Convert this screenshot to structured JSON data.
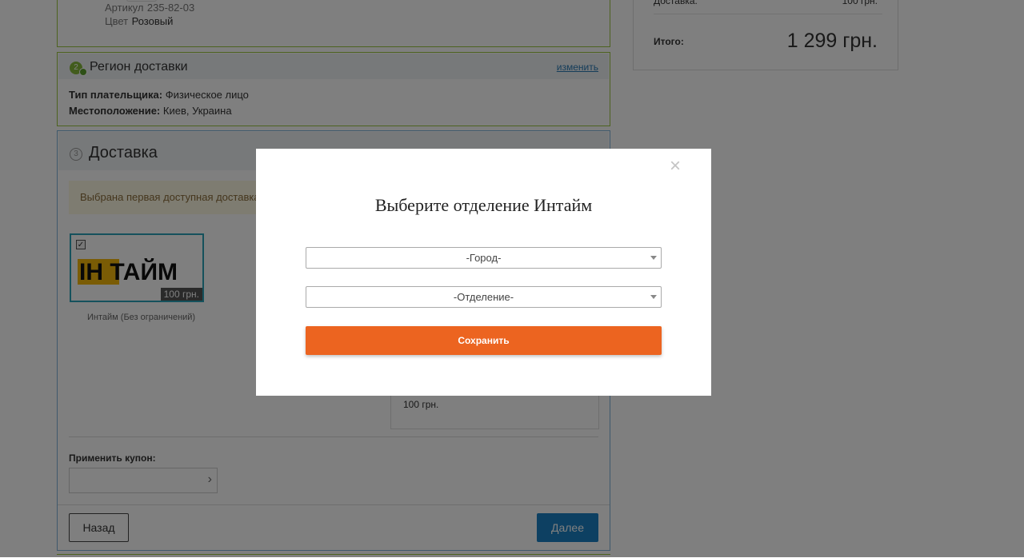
{
  "product": {
    "article_label": "Артикул",
    "article_value": "235-82-03",
    "color_label": "Цвет",
    "color_value": "Розовый"
  },
  "region": {
    "step": "2",
    "title": "Регион доставки",
    "change_link": "изменить",
    "payer_label": "Тип плательщика:",
    "payer_value": "Физическое лицо",
    "location_label": "Местоположение:",
    "location_value": "Киев, Украина"
  },
  "delivery": {
    "step": "3",
    "title": "Доставка",
    "notice": "Выбрана первая доступная доставка",
    "card_logo_part1": "ІН",
    "card_logo_part2": "ТАЙМ",
    "card_price": "100 грн.",
    "card_name": "Интайм (Без ограничений)",
    "detail_price": "100 грн."
  },
  "coupon": {
    "label": "Применить купон:",
    "placeholder": ""
  },
  "nav": {
    "back": "Назад",
    "next": "Далее"
  },
  "summary": {
    "delivery_label": "Доставка:",
    "delivery_value": "100 грн.",
    "total_label": "Итого:",
    "total_value": "1 299 грн."
  },
  "modal": {
    "title": "Выберите отделение Интайм",
    "close_icon": "×",
    "city_select": "-Город-",
    "branch_select": "-Отделение-",
    "save": "Сохранить"
  },
  "colors": {
    "accent_orange": "#ec6420",
    "primary_blue": "#1a80c4",
    "panel_green": "#9bc740",
    "logo_yellow": "#f5b90a"
  }
}
